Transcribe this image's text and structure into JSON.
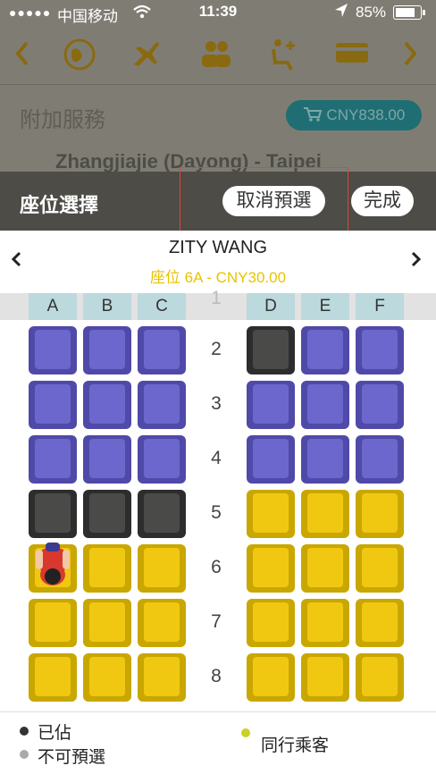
{
  "status_bar": {
    "signal": "●●●●●",
    "carrier": "中国移动",
    "time": "11:39",
    "battery": "85%"
  },
  "background_page": {
    "section_title": "附加服務",
    "total_price": "CNY838.00",
    "route": "Zhangjiajie (Dayong) - Taipei",
    "nav_icons": [
      "chevron-left-icon",
      "globe-icon",
      "plane-icon",
      "passengers-icon",
      "seat-icon",
      "card-icon",
      "chevron-right-icon"
    ]
  },
  "header": {
    "title": "座位選擇",
    "cancel_label": "取消預選",
    "done_label": "完成"
  },
  "passenger": {
    "name": "ZITY WANG",
    "seat_info": "座位 6A - CNY30.00"
  },
  "seat_map": {
    "left_columns": [
      "A",
      "B",
      "C"
    ],
    "right_columns": [
      "D",
      "E",
      "F"
    ],
    "rows": [
      {
        "number": "1"
      },
      {
        "number": "2",
        "seats": [
          "available",
          "available",
          "available",
          "occupied",
          "available",
          "available"
        ]
      },
      {
        "number": "3",
        "seats": [
          "available",
          "available",
          "available",
          "available",
          "available",
          "available"
        ]
      },
      {
        "number": "4",
        "seats": [
          "available",
          "available",
          "available",
          "available",
          "available",
          "available"
        ]
      },
      {
        "number": "5",
        "seats": [
          "occupied",
          "occupied",
          "occupied",
          "premium",
          "premium",
          "premium"
        ]
      },
      {
        "number": "6",
        "seats": [
          "selected",
          "premium",
          "premium",
          "premium",
          "premium",
          "premium"
        ]
      },
      {
        "number": "7",
        "seats": [
          "premium",
          "premium",
          "premium",
          "premium",
          "premium",
          "premium"
        ]
      },
      {
        "number": "8",
        "seats": [
          "premium",
          "premium",
          "premium",
          "premium",
          "premium",
          "premium"
        ]
      }
    ]
  },
  "legend": {
    "occupied": "已佔",
    "not_preselectable": "不可預選",
    "companion": "同行乘客"
  },
  "colors": {
    "available": "#6c67cc",
    "occupied": "#4a4a48",
    "premium": "#f0c812",
    "header_bg": "#4d4c47",
    "seat_price_text": "#e7c400",
    "legend_companion": "#c7d22a"
  }
}
